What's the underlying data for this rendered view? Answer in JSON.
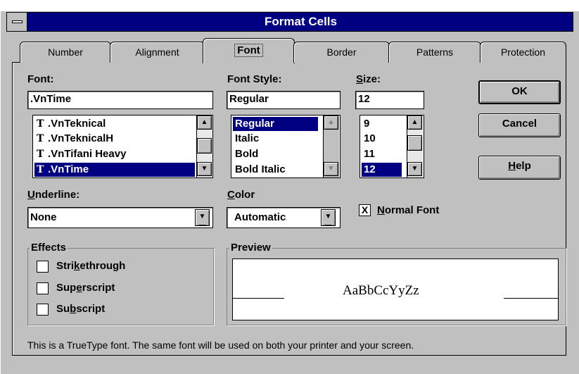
{
  "window": {
    "title": "Format Cells"
  },
  "tabs": [
    {
      "label": "Number"
    },
    {
      "label": "Alignment"
    },
    {
      "label": "Font"
    },
    {
      "label": "Border"
    },
    {
      "label": "Patterns"
    },
    {
      "label": "Protection"
    }
  ],
  "font": {
    "label": "Font:",
    "value": ".VnTime",
    "items": [
      ".VnTeknical",
      ".VnTeknicalH",
      ".VnTifani Heavy",
      ".VnTime"
    ],
    "selected": ".VnTime",
    "icon": "truetype-icon",
    "icon_glyph": "T"
  },
  "font_style": {
    "label": "Font Style:",
    "value": "Regular",
    "items": [
      "Regular",
      "Italic",
      "Bold",
      "Bold Italic"
    ],
    "selected": "Regular"
  },
  "size": {
    "label": "Size:",
    "value": "12",
    "items": [
      "9",
      "10",
      "11",
      "12"
    ],
    "selected": "12"
  },
  "buttons": {
    "ok": "OK",
    "cancel": "Cancel",
    "help": "Help"
  },
  "underline": {
    "label": "Underline:",
    "value": "None"
  },
  "color": {
    "label": "Color",
    "value": "Automatic"
  },
  "normal_font": {
    "label": "Normal Font",
    "checked": true,
    "mark": "X"
  },
  "effects": {
    "label": "Effects",
    "items": [
      {
        "label": "Strikethrough",
        "checked": false
      },
      {
        "label": "Superscript",
        "checked": false
      },
      {
        "label": "Subscript",
        "checked": false
      }
    ]
  },
  "preview": {
    "label": "Preview",
    "sample": "AaBbCcYyZz"
  },
  "status_text": "This is a TrueType font.  The same font will be used on both your printer and your screen.",
  "colors": {
    "titlebar": "#000080",
    "face": "#c0c0c0",
    "selection": "#000080"
  }
}
